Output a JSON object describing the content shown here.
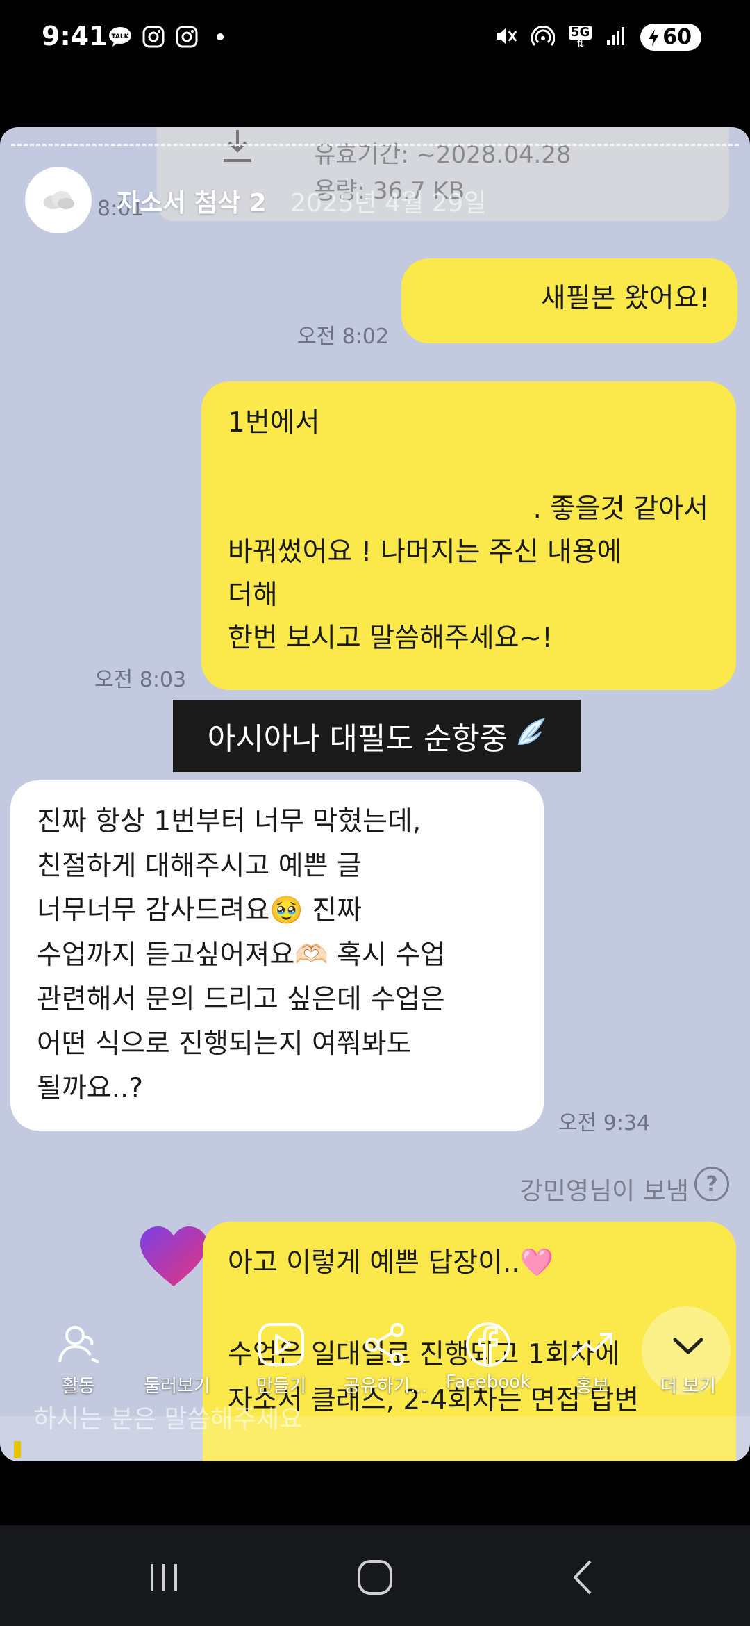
{
  "status_bar": {
    "time": "9:41",
    "talk_badge": "TALK",
    "network": "5G",
    "battery": "60",
    "icons": [
      "kakaotalk-icon",
      "instagram-icon",
      "instagram-icon",
      "dot-icon",
      "mute-icon",
      "hotspot-icon",
      "5g-icon",
      "signal-icon",
      "battery-icon"
    ]
  },
  "story": {
    "title": "자소서 첨삭 2",
    "date": "2025년 4월 29일",
    "file_card": {
      "expiry": "유효기간: ~2028.04.28",
      "size": "용량: 36.7 KB"
    },
    "timestamps": {
      "t0": "8:01",
      "t1": "오전 8:02",
      "t2": "오전 8:03",
      "t3": "오전 9:34"
    },
    "messages": {
      "m1": "새필본 왔어요!",
      "m2": {
        "l1": "1번에서",
        "l2": ". 좋을것 같아서",
        "l3": "바꿔썼어요 ! 나머지는 주신 내용에",
        "l4": "더해",
        "l5": "한번 보시고 말씀해주세요~!"
      },
      "banner": "아시아나 대필도 순항중",
      "m3": {
        "l1": "진짜 항상 1번부터 너무 막혔는데,",
        "l2": "친절하게 대해주시고 예쁜 글",
        "l3": "너무너무 감사드려요🥹 진짜",
        "l4": "수업까지 듣고싶어져요🫶🏻 혹시 수업",
        "l5": "관련해서 문의 드리고 싶은데 수업은",
        "l6": "어떤 식으로 진행되는지 여쭤봐도",
        "l7": "될까요..?"
      },
      "sent_by": "강민영님이 보냄",
      "help": "?",
      "m4": {
        "l1": "아고 이렇게 예쁜 답장이..🩷",
        "l2": "수업은 일대일로 진행되고 1회차에",
        "l3": "자소서 클래스, 2-4회차는 면접 답변"
      },
      "faded": "하시는 분은 말씀해주세요"
    }
  },
  "actions": [
    {
      "label": "활동",
      "icon": "activity-icon"
    },
    {
      "label": "둘러보기",
      "icon": "explore-icon"
    },
    {
      "label": "만들기",
      "icon": "create-icon"
    },
    {
      "label": "공유하기...",
      "icon": "share-icon"
    },
    {
      "label": "Facebook",
      "icon": "facebook-icon"
    },
    {
      "label": "홍보",
      "icon": "promote-icon"
    },
    {
      "label": "더 보기",
      "icon": "more-icon"
    }
  ],
  "colors": {
    "chat_bg": "#c3cadf",
    "my_bubble": "#fbe84a",
    "their_bubble": "#ffffff",
    "banner_bg": "#1a1a1a"
  }
}
